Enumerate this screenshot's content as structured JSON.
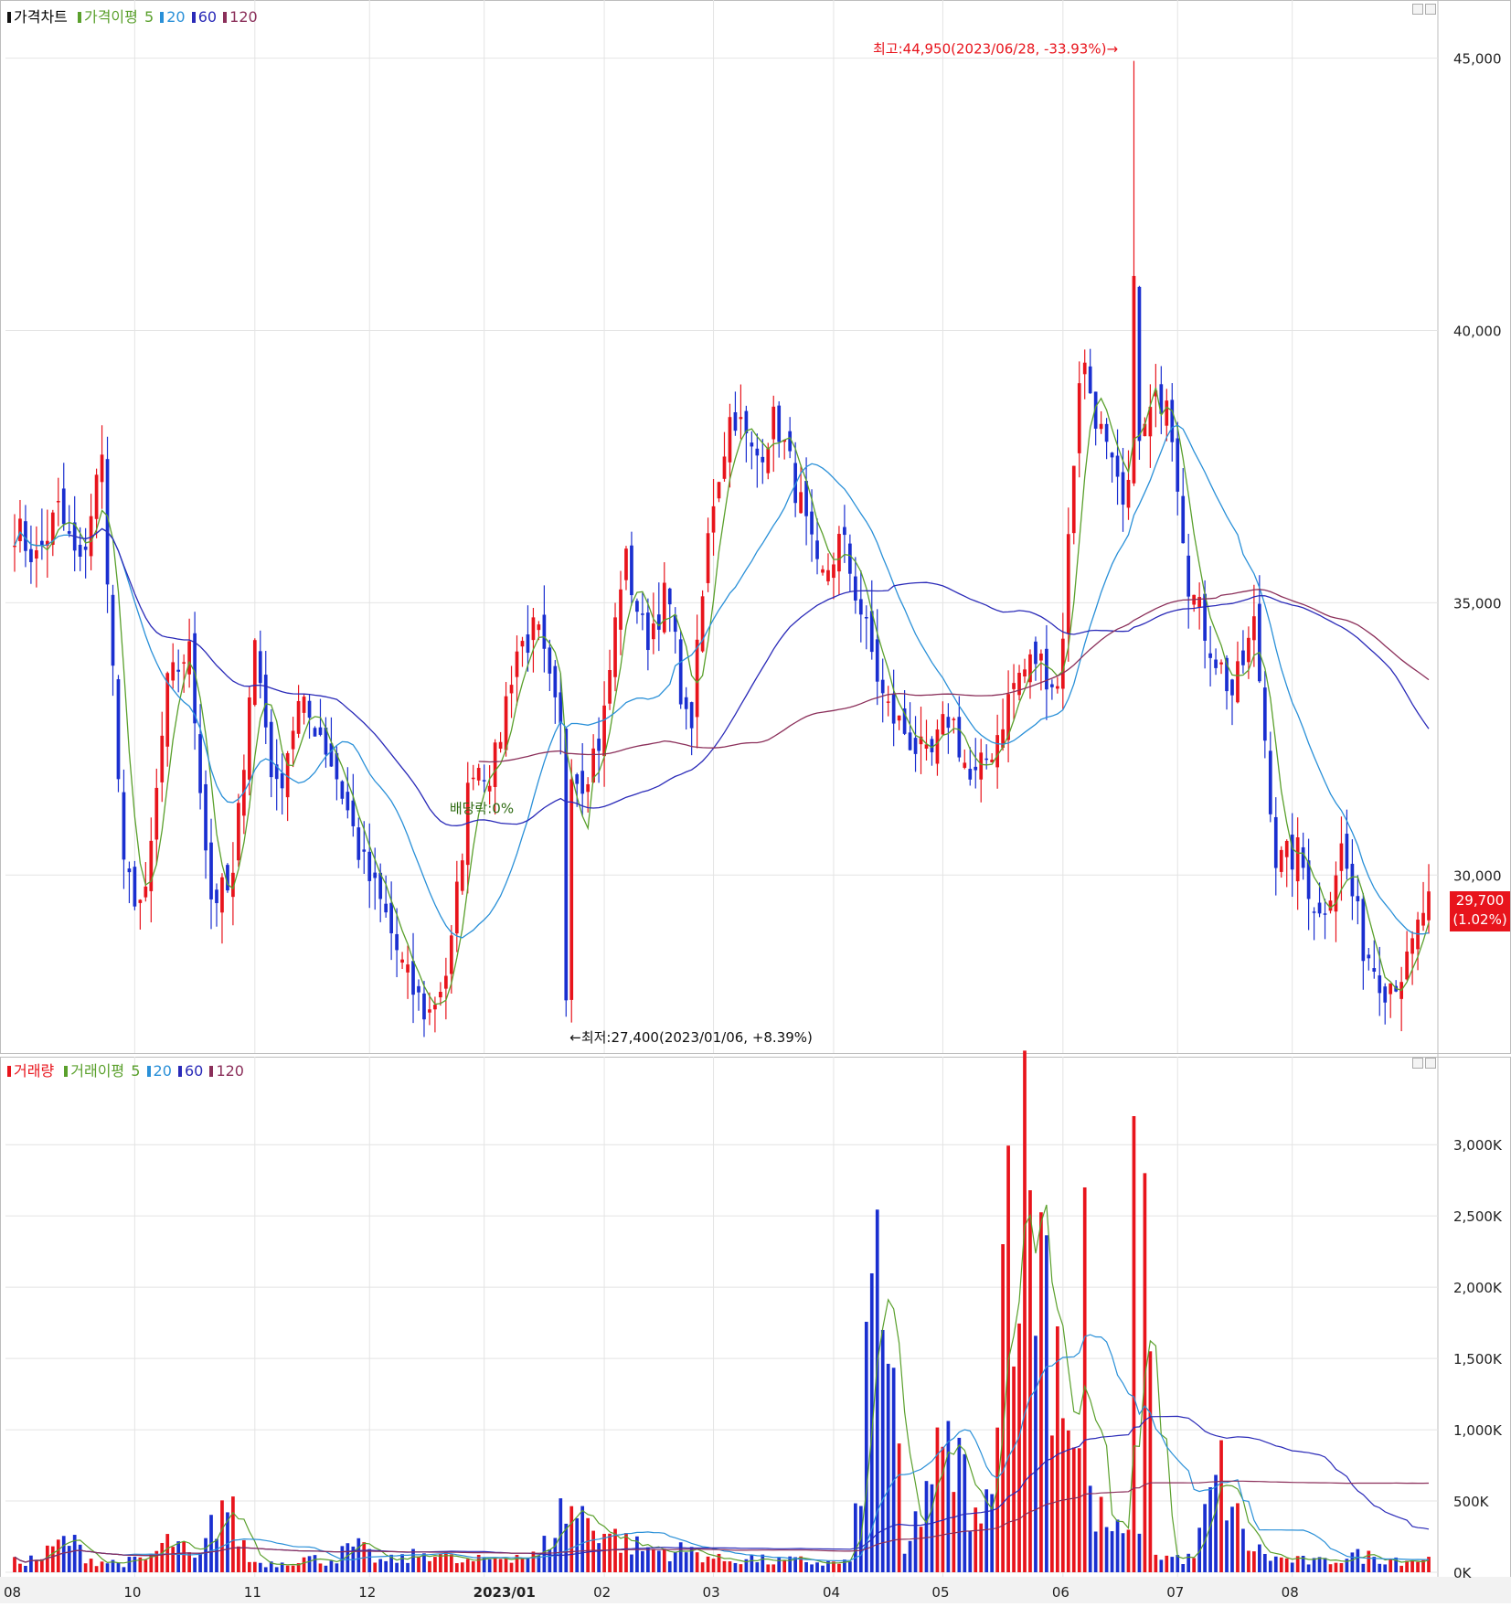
{
  "price_panel": {
    "legend": {
      "label": "가격차트",
      "ma_label": "가격이평",
      "periods": [
        "5",
        "20",
        "60",
        "120"
      ]
    },
    "y_ticks": [
      "45,000",
      "40,000",
      "35,000",
      "30,000"
    ],
    "high_annotation": "최고:44,950(2023/06/28, -33.93%)→",
    "low_annotation": "←최저:27,400(2023/01/06, +8.39%)",
    "dividend_annotation": "배당락:0%",
    "last_price": "29,700",
    "last_change": "(1.02%)"
  },
  "volume_panel": {
    "legend": {
      "label": "거래량",
      "ma_label": "거래이평",
      "periods": [
        "5",
        "20",
        "60",
        "120"
      ]
    },
    "y_ticks": [
      "3,000K",
      "2,500K",
      "2,000K",
      "1,500K",
      "1,000K",
      "500K",
      "0K"
    ]
  },
  "x_axis": {
    "labels": [
      "08",
      "10",
      "11",
      "12",
      "2023/01",
      "02",
      "03",
      "04",
      "05",
      "06",
      "07",
      "08"
    ]
  },
  "colors": {
    "up": "#e8141c",
    "down": "#1a2fd0",
    "ma5": "#5aa02c",
    "ma20": "#2a90d8",
    "ma60": "#2a2ab8",
    "ma120": "#8b2f5a",
    "grid": "#e4e4e4"
  },
  "chart_data": [
    {
      "type": "candlestick",
      "y_range": [
        26900,
        45900
      ],
      "x": [
        "2022/08",
        "2022/10",
        "2022/11",
        "2022/12",
        "2023/01",
        "2023/02",
        "2023/03",
        "2023/04",
        "2023/05",
        "2023/06",
        "2023/07",
        "2023/08"
      ],
      "price_anchors": [
        36400,
        35800,
        36700,
        35600,
        37700,
        30000,
        29400,
        33400,
        34200,
        29600,
        29700,
        34400,
        31400,
        33100,
        32700,
        31600,
        30200,
        29300,
        28100,
        27400,
        28400,
        32100,
        31900,
        34100,
        34500,
        32700,
        31700,
        32600,
        35900,
        34300,
        35200,
        32400,
        36700,
        38600,
        37600,
        38400,
        37000,
        35300,
        36200,
        34700,
        33100,
        32600,
        32000,
        33000,
        31600,
        32400,
        33600,
        34000,
        33400,
        39600,
        38000,
        36600,
        38300,
        39000,
        35300,
        34200,
        33300,
        34600,
        30200,
        30400,
        29200,
        30500,
        28700,
        28000,
        28300,
        29700
      ],
      "highest": {
        "value": 44950,
        "date": "2023/06/28",
        "change": "-33.93%"
      },
      "lowest": {
        "value": 27400,
        "date": "2023/01/06",
        "change": "+8.39%"
      },
      "last": {
        "value": 29700,
        "change": "1.02%"
      },
      "moving_averages": [
        "5",
        "20",
        "60",
        "120"
      ]
    },
    {
      "type": "bar",
      "y_range": [
        0,
        3200
      ],
      "y_unit": "K",
      "volume_anchors_k": [
        80,
        110,
        260,
        90,
        75,
        95,
        250,
        70,
        580,
        80,
        70,
        110,
        90,
        200,
        80,
        110,
        170,
        70,
        100,
        140,
        120,
        500,
        410,
        260,
        180,
        170,
        160,
        90,
        110,
        80,
        90,
        70,
        80,
        2700,
        90,
        780,
        880,
        220,
        3200,
        2800,
        1600,
        530,
        300,
        200,
        120,
        100,
        790,
        230,
        110,
        90,
        80,
        130,
        120,
        100,
        100
      ],
      "moving_averages": [
        "5",
        "20",
        "60",
        "120"
      ]
    }
  ]
}
